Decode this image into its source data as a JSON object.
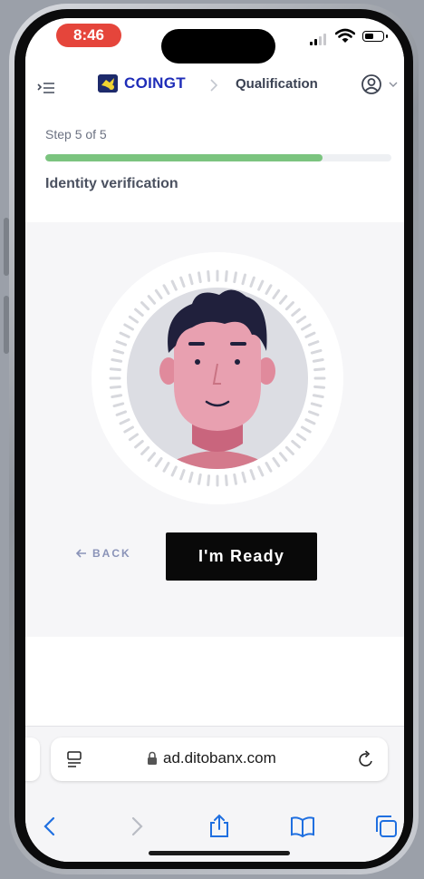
{
  "status_bar": {
    "time": "8:46"
  },
  "header": {
    "brand": "COINGT",
    "page_title": "Qualification"
  },
  "step": {
    "label": "Step 5 of 5",
    "progress_fraction": 0.8,
    "section_title": "Identity verification"
  },
  "verification": {
    "back_label": "BACK",
    "ready_label": "I'm Ready"
  },
  "browser": {
    "url": "ad.ditobanx.com"
  },
  "colors": {
    "brand": "#1f2db8",
    "progress": "#7bc47f",
    "time_pill": "#e5453b",
    "button": "#090909"
  }
}
